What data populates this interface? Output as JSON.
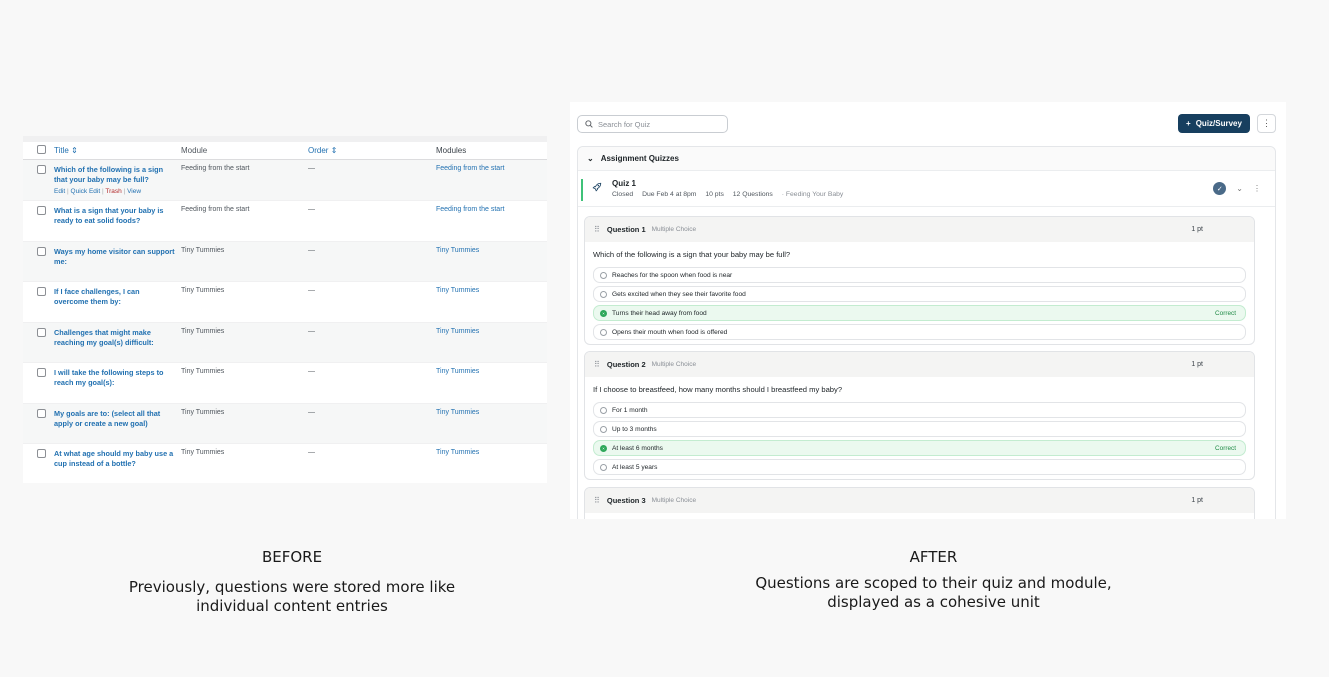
{
  "before": {
    "headers": {
      "title": "Title",
      "module": "Module",
      "order": "Order",
      "modules": "Modules"
    },
    "sort_glyph": "⇕",
    "rows": [
      {
        "title": "Which of the following is a sign that your baby may be full?",
        "module": "Feeding from the start",
        "order": "—",
        "modules": "Feeding from the start"
      },
      {
        "title": "What is a sign that your baby is ready to eat solid foods?",
        "module": "Feeding from the start",
        "order": "—",
        "modules": "Feeding from the start"
      },
      {
        "title": "Ways my home visitor can support me:",
        "module": "Tiny Tummies",
        "order": "—",
        "modules": "Tiny Tummies"
      },
      {
        "title": "If I face challenges, I can overcome them by:",
        "module": "Tiny Tummies",
        "order": "—",
        "modules": "Tiny Tummies"
      },
      {
        "title": "Challenges that might make reaching my goal(s) difficult:",
        "module": "Tiny Tummies",
        "order": "—",
        "modules": "Tiny Tummies"
      },
      {
        "title": "I will take the following steps to reach my goal(s):",
        "module": "Tiny Tummies",
        "order": "—",
        "modules": "Tiny Tummies"
      },
      {
        "title": "My goals are to: (select all that apply or create a new goal)",
        "module": "Tiny Tummies",
        "order": "—",
        "modules": "Tiny Tummies"
      },
      {
        "title": "At what age should my baby use a cup instead of a bottle?",
        "module": "Tiny Tummies",
        "order": "—",
        "modules": "Tiny Tummies"
      }
    ],
    "row_actions": {
      "edit": "Edit",
      "quick_edit": "Quick Edit",
      "trash": "Trash",
      "view": "View",
      "separator": "|"
    }
  },
  "after": {
    "search_placeholder": "Search for Quiz",
    "add_button": "Quiz/Survey",
    "add_glyph": "+",
    "kebab_glyph": "⋮",
    "section_title": "Assignment Quizzes",
    "quiz": {
      "name": "Quiz 1",
      "status": "Closed",
      "due": "Due Feb 4 at 8pm",
      "points": "10 pts",
      "questions": "12 Questions",
      "module": "· Feeding Your Baby"
    },
    "correct_label": "Correct",
    "questions": [
      {
        "number": "Question 1",
        "type": "Multiple Choice",
        "points": "1 pt",
        "text": "Which of the following is a sign that your baby may be full?",
        "options": [
          {
            "label": "Reaches for the spoon when food is near"
          },
          {
            "label": "Gets excited when they see their favorite food"
          },
          {
            "label": "Turns their head away from food",
            "correct": true
          },
          {
            "label": "Opens their mouth when food is offered"
          }
        ]
      },
      {
        "number": "Question 2",
        "type": "Multiple Choice",
        "points": "1 pt",
        "text": "If I choose to breastfeed, how many months should I breastfeed my baby?",
        "options": [
          {
            "label": "For 1 month"
          },
          {
            "label": "Up to 3 months"
          },
          {
            "label": "At least 6 months",
            "correct": true
          },
          {
            "label": "At least 5 years"
          }
        ]
      },
      {
        "number": "Question 3",
        "type": "Multiple Choice",
        "points": "1 pt"
      }
    ]
  },
  "captions": {
    "before_heading": "BEFORE",
    "before_text_1": "Previously, questions were stored more like",
    "before_text_2": "individual content entries",
    "after_heading": "AFTER",
    "after_text_1": "Questions are scoped to their quiz and module,",
    "after_text_2": "displayed as a cohesive unit"
  }
}
